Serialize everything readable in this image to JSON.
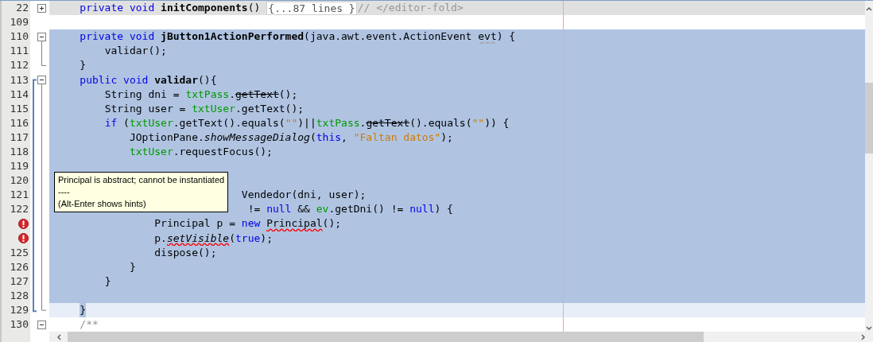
{
  "editor": {
    "lines": [
      {
        "number": "22",
        "kind": "fold-header",
        "expanded": false,
        "selected": false,
        "current": false,
        "tokens": [
          {
            "t": "    private void",
            "kind": "keyword"
          },
          {
            "t": " initComponents",
            "kind": "decl"
          },
          {
            "t": "() "
          },
          {
            "t": "{...87 lines }",
            "kind": "fold"
          },
          {
            "t": "// </editor-fold>",
            "kind": "comment"
          }
        ]
      },
      {
        "number": "109",
        "kind": "code",
        "selected": false,
        "current": false
      },
      {
        "number": "110",
        "kind": "fold-header",
        "expanded": true,
        "selected": true,
        "current": false,
        "tokens": [
          {
            "t": "    private void",
            "kind": "keyword"
          },
          {
            "t": " jButton1ActionPerformed",
            "kind": "decl"
          },
          {
            "t": "(java.awt.event.ActionEvent "
          },
          {
            "t": "evt",
            "kind": "warning"
          },
          {
            "t": ") {"
          }
        ]
      },
      {
        "number": "111",
        "kind": "code",
        "selected": true,
        "current": false,
        "tokens": [
          {
            "t": "        validar();"
          }
        ]
      },
      {
        "number": "112",
        "kind": "fold-end",
        "selected": true,
        "current": false,
        "tokens": [
          {
            "t": "    }"
          }
        ]
      },
      {
        "number": "113",
        "kind": "fold-header",
        "expanded": true,
        "selected": true,
        "current": false,
        "tokens": [
          {
            "t": "    public void",
            "kind": "keyword"
          },
          {
            "t": " validar",
            "kind": "decl"
          },
          {
            "t": "(){"
          }
        ]
      },
      {
        "number": "114",
        "kind": "code",
        "selected": true,
        "current": false,
        "tokens": [
          {
            "t": "        String dni = "
          },
          {
            "t": "txtPass",
            "kind": "field"
          },
          {
            "t": "."
          },
          {
            "t": "getText",
            "kind": "deprecated"
          },
          {
            "t": "();"
          }
        ]
      },
      {
        "number": "115",
        "kind": "code",
        "selected": true,
        "current": false,
        "tokens": [
          {
            "t": "        String user = "
          },
          {
            "t": "txtUser",
            "kind": "field"
          },
          {
            "t": ".getText();"
          }
        ]
      },
      {
        "number": "116",
        "kind": "code",
        "selected": true,
        "current": false,
        "tokens": [
          {
            "t": "        if",
            "kind": "keyword"
          },
          {
            "t": " ("
          },
          {
            "t": "txtUser",
            "kind": "field"
          },
          {
            "t": ".getText().equals("
          },
          {
            "t": "\"\"",
            "kind": "string"
          },
          {
            "t": ")||"
          },
          {
            "t": "txtPass",
            "kind": "field"
          },
          {
            "t": "."
          },
          {
            "t": "getText",
            "kind": "deprecated"
          },
          {
            "t": "().equals("
          },
          {
            "t": "\"\"",
            "kind": "string"
          },
          {
            "t": ")) {"
          }
        ]
      },
      {
        "number": "117",
        "kind": "code",
        "selected": true,
        "current": false,
        "tokens": [
          {
            "t": "            JOptionPane."
          },
          {
            "t": "showMessageDialog",
            "kind": "static"
          },
          {
            "t": "("
          },
          {
            "t": "this",
            "kind": "keyword"
          },
          {
            "t": ", "
          },
          {
            "t": "\"Faltan datos\"",
            "kind": "string"
          },
          {
            "t": ");"
          }
        ]
      },
      {
        "number": "118",
        "kind": "code",
        "selected": true,
        "current": false,
        "tokens": [
          {
            "t": "            txtUser",
            "kind": "field"
          },
          {
            "t": ".requestFocus();"
          }
        ]
      },
      {
        "number": "119",
        "kind": "code",
        "selected": true,
        "current": false
      },
      {
        "number": "120",
        "kind": "code",
        "selected": true,
        "current": false
      },
      {
        "number": "121",
        "kind": "code",
        "selected": true,
        "current": false,
        "tokens": [
          {
            "t": "                              Vendedor(dni, user);"
          }
        ]
      },
      {
        "number": "122",
        "kind": "code",
        "selected": true,
        "current": false,
        "tokens": [
          {
            "t": "                               != "
          },
          {
            "t": "null",
            "kind": "keyword"
          },
          {
            "t": " && "
          },
          {
            "t": "ev",
            "kind": "field"
          },
          {
            "t": ".getDni() != "
          },
          {
            "t": "null",
            "kind": "keyword"
          },
          {
            "t": ") {"
          }
        ]
      },
      {
        "kind": "code",
        "error": true,
        "selected": true,
        "current": false,
        "tokens": [
          {
            "t": "                Principal p = "
          },
          {
            "t": "new ",
            "kind": "keyword"
          },
          {
            "t": "Principal",
            "kind": "error"
          },
          {
            "t": "();"
          }
        ]
      },
      {
        "kind": "code",
        "error": true,
        "selected": true,
        "current": false,
        "tokens": [
          {
            "t": "                p."
          },
          {
            "t": "setVisible",
            "kind": "static-error"
          },
          {
            "t": "("
          },
          {
            "t": "true",
            "kind": "keyword"
          },
          {
            "t": ");"
          }
        ]
      },
      {
        "number": "125",
        "kind": "code",
        "selected": true,
        "current": false,
        "tokens": [
          {
            "t": "                dispose();"
          }
        ]
      },
      {
        "number": "126",
        "kind": "code",
        "selected": true,
        "current": false,
        "tokens": [
          {
            "t": "            }"
          }
        ]
      },
      {
        "number": "127",
        "kind": "code",
        "selected": true,
        "current": false,
        "tokens": [
          {
            "t": "        }"
          }
        ]
      },
      {
        "number": "128",
        "kind": "code",
        "selected": true,
        "current": false
      },
      {
        "number": "129",
        "kind": "fold-end",
        "selected": true,
        "current": true,
        "tokens": [
          {
            "t": "    }"
          }
        ]
      },
      {
        "number": "130",
        "kind": "fold-header",
        "expanded": true,
        "selected": false,
        "current": false,
        "tokens": [
          {
            "t": "    /**",
            "kind": "comment"
          }
        ]
      }
    ]
  },
  "tooltip": {
    "lines": [
      "Principal is abstract; cannot be instantiated",
      "----",
      "(Alt-Enter shows hints)"
    ]
  }
}
